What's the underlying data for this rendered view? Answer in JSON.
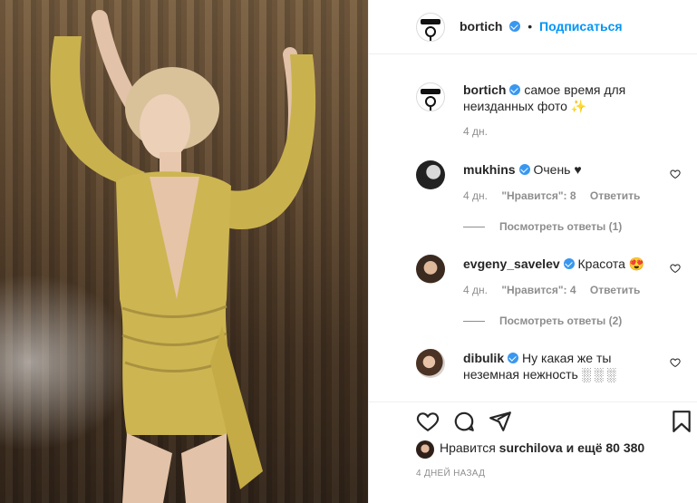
{
  "post": {
    "author": "bortich",
    "follow_label": "Подписаться",
    "dot": "•",
    "caption": "самое время для неизданных фото ✨",
    "caption_age": "4 дн."
  },
  "comments": [
    {
      "user": "mukhins",
      "text": "Очень ♥",
      "age": "4 дн.",
      "likes": "\"Нравится\": 8",
      "reply": "Ответить",
      "view_replies": "Посмотреть ответы (1)"
    },
    {
      "user": "evgeny_savelev",
      "text": "Красота 😍",
      "age": "4 дн.",
      "likes": "\"Нравится\": 4",
      "reply": "Ответить",
      "view_replies": "Посмотреть ответы (2)"
    },
    {
      "user": "dibulik",
      "text": "Ну какая же ты неземная нежность ░ ░ ░"
    }
  ],
  "footer": {
    "likes_prefix": "Нравится",
    "liked_by": "surchilova",
    "likes_suffix": "и ещё 80 380",
    "date": "4 ДНЕЙ НАЗАД"
  },
  "icons": {
    "like": "heart-icon",
    "comment": "comment-icon",
    "share": "share-icon",
    "save": "bookmark-icon"
  },
  "colors": {
    "accent": "#0095f6",
    "verified": "#3897f0",
    "muted": "#8e8e8e"
  }
}
